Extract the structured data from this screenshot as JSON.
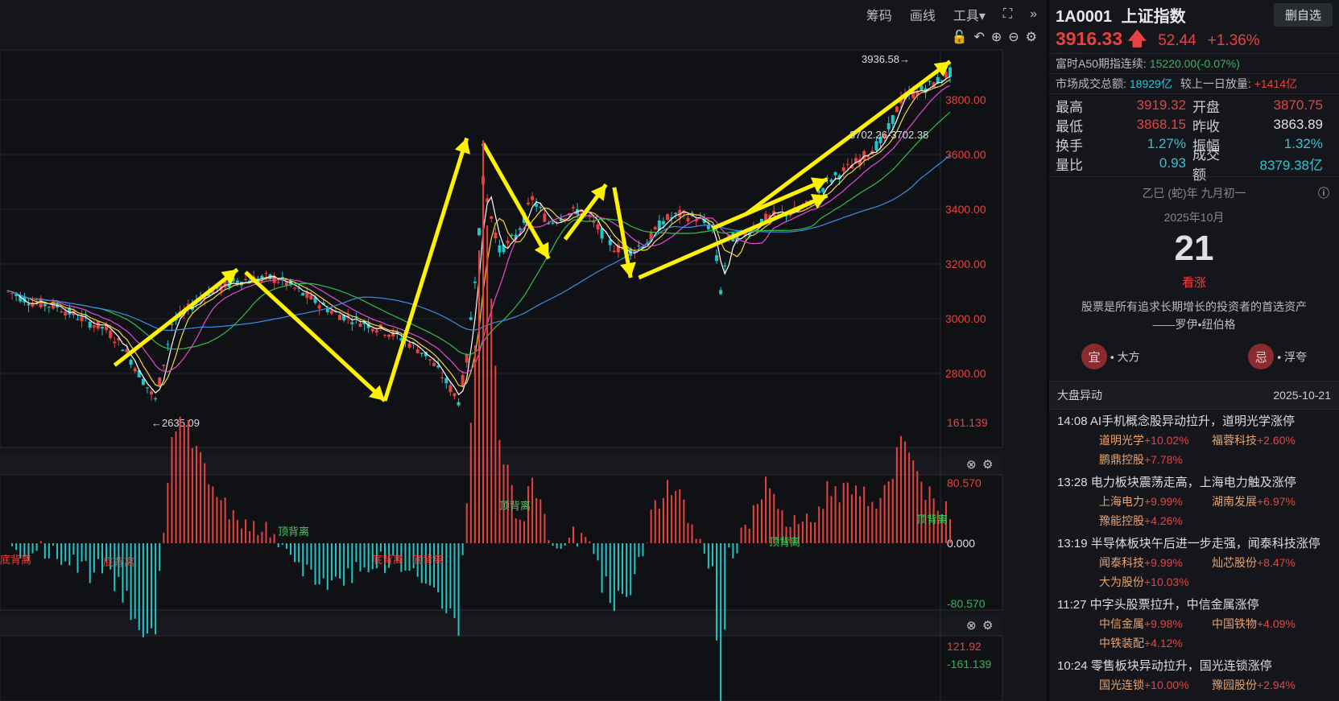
{
  "toolbar": {
    "chips": "筹码",
    "draw": "画线",
    "tools": "工具▾"
  },
  "header": {
    "code": "1A0001",
    "name": "上证指数",
    "delete_btn": "删自选"
  },
  "quote": {
    "price": "3916.33",
    "change": "52.44",
    "change_pct": "+1.36%"
  },
  "a50": {
    "label": "富时A50期指连续:",
    "value": "15220.00(-0.07%)"
  },
  "turnover_total": {
    "label": "市场成交总额:",
    "value": "18929亿",
    "vs_label": "较上一日放量:",
    "vs_value": "+1414亿"
  },
  "stats": {
    "high_label": "最高",
    "high": "3919.32",
    "open_label": "开盘",
    "open": "3870.75",
    "low_label": "最低",
    "low": "3868.15",
    "prev_label": "昨收",
    "prev": "3863.89",
    "turn_label": "换手",
    "turn": "1.27%",
    "amp_label": "振幅",
    "amp": "1.32%",
    "vr_label": "量比",
    "vr": "0.93",
    "amount_label": "成交额",
    "amount": "8379.38亿"
  },
  "calendar": {
    "lunar": "乙巳 (蛇)年 九月初一",
    "month": "2025年10月",
    "day": "21",
    "mood": "看涨",
    "quote": "股票是所有追求长期增长的投资者的首选资产",
    "author": "——罗伊•纽伯格",
    "good_tag": "宜",
    "good_text": "• 大方",
    "bad_tag": "忌",
    "bad_text": "• 浮夸"
  },
  "news": {
    "title": "大盘异动",
    "date": "2025-10-21",
    "items": [
      {
        "time": "14:08",
        "text": "AI手机概念股异动拉升，道明光学涨停",
        "stocks": [
          {
            "name": "道明光学",
            "chg": "+10.02%"
          },
          {
            "name": "福蓉科技",
            "chg": "+2.60%"
          },
          {
            "name": "鹏鼎控股",
            "chg": "+7.78%"
          }
        ]
      },
      {
        "time": "13:28",
        "text": "电力板块震荡走高，上海电力触及涨停",
        "stocks": [
          {
            "name": "上海电力",
            "chg": "+9.99%"
          },
          {
            "name": "湖南发展",
            "chg": "+6.97%"
          },
          {
            "name": "豫能控股",
            "chg": "+4.26%"
          }
        ]
      },
      {
        "time": "13:19",
        "text": "半导体板块午后进一步走强，闻泰科技涨停",
        "stocks": [
          {
            "name": "闻泰科技",
            "chg": "+9.99%"
          },
          {
            "name": "灿芯股份",
            "chg": "+8.47%"
          },
          {
            "name": "大为股份",
            "chg": "+10.03%"
          }
        ]
      },
      {
        "time": "11:27",
        "text": "中字头股票拉升，中信金属涨停",
        "stocks": [
          {
            "name": "中信金属",
            "chg": "+9.98%"
          },
          {
            "name": "中国铁物",
            "chg": "+4.09%"
          },
          {
            "name": "中铁装配",
            "chg": "+4.12%"
          }
        ]
      },
      {
        "time": "10:24",
        "text": "零售板块异动拉升，国光连锁涨停",
        "stocks": [
          {
            "name": "国光连锁",
            "chg": "+10.00%"
          },
          {
            "name": "豫园股份",
            "chg": "+2.94%"
          }
        ]
      }
    ]
  },
  "chart_data": [
    {
      "type": "candlestick",
      "y_ticks": [
        "3800.00",
        "3600.00",
        "3400.00",
        "3200.00",
        "3000.00",
        "2800.00"
      ],
      "annotations": {
        "high_mark": "3936.58→",
        "low_mark": "←2635.09",
        "level_mark": "3702.26-3702.38"
      },
      "price_path": [
        [
          0,
          3100
        ],
        [
          3,
          3060
        ],
        [
          6,
          3045
        ],
        [
          9,
          3000
        ],
        [
          12,
          2960
        ],
        [
          14,
          2900
        ],
        [
          16,
          2800
        ],
        [
          18,
          2700
        ],
        [
          20,
          2980
        ],
        [
          24,
          3090
        ],
        [
          28,
          3140
        ],
        [
          32,
          3150
        ],
        [
          34,
          3130
        ],
        [
          36,
          3090
        ],
        [
          40,
          3020
        ],
        [
          44,
          2980
        ],
        [
          48,
          2930
        ],
        [
          51,
          2870
        ],
        [
          53,
          2790
        ],
        [
          55,
          2700
        ],
        [
          56,
          2850
        ],
        [
          57,
          3150
        ],
        [
          58,
          3500
        ],
        [
          60,
          3250
        ],
        [
          62,
          3300
        ],
        [
          64,
          3440
        ],
        [
          66,
          3350
        ],
        [
          68,
          3380
        ],
        [
          70,
          3400
        ],
        [
          72,
          3330
        ],
        [
          74,
          3260
        ],
        [
          76,
          3250
        ],
        [
          78,
          3280
        ],
        [
          80,
          3360
        ],
        [
          82,
          3380
        ],
        [
          84,
          3370
        ],
        [
          86,
          3330
        ],
        [
          87,
          3100
        ],
        [
          88,
          3290
        ],
        [
          90,
          3310
        ],
        [
          92,
          3360
        ],
        [
          94,
          3380
        ],
        [
          96,
          3390
        ],
        [
          98,
          3420
        ],
        [
          100,
          3500
        ],
        [
          104,
          3580
        ],
        [
          107,
          3660
        ],
        [
          109,
          3800
        ],
        [
          111,
          3830
        ],
        [
          113,
          3860
        ],
        [
          115,
          3900
        ]
      ]
    },
    {
      "type": "macd",
      "y_ticks": [
        "161.139",
        "80.570",
        "0.000",
        "-80.570",
        "-161.139"
      ],
      "labels": {
        "top_div": "顶背离",
        "bottom_div": "底背离"
      }
    },
    {
      "type": "line",
      "y_ticks": [
        "121.92"
      ]
    }
  ]
}
